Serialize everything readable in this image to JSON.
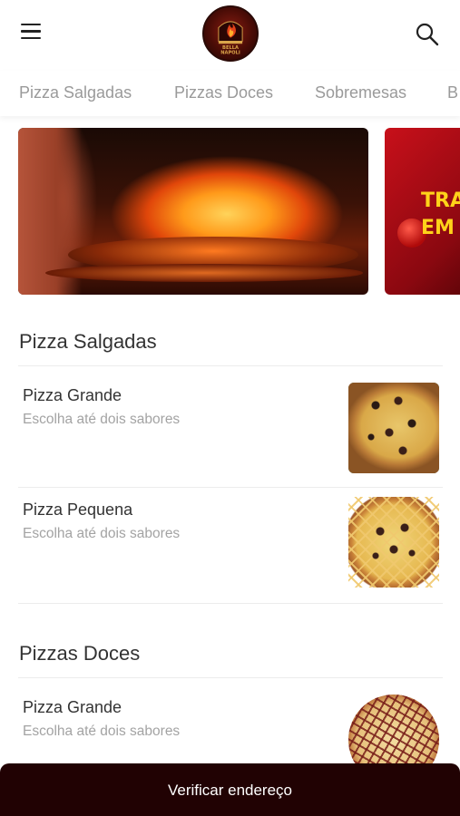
{
  "header": {
    "menu_icon": "hamburger-menu-icon",
    "logo_text": "BELLA NAPOLI",
    "search_icon": "search-icon"
  },
  "categories": [
    {
      "label": "Pizza Salgadas"
    },
    {
      "label": "Pizzas Doces"
    },
    {
      "label": "Sobremesas"
    },
    {
      "label": "B"
    }
  ],
  "banners": [
    {
      "name": "wood-fired-oven"
    },
    {
      "name": "promo",
      "text_line1": "TRA",
      "text_line2": "EM"
    }
  ],
  "sections": [
    {
      "title": "Pizza Salgadas",
      "products": [
        {
          "name": "Pizza Grande",
          "description": "Escolha até dois sabores"
        },
        {
          "name": "Pizza Pequena",
          "description": "Escolha até dois sabores"
        }
      ]
    },
    {
      "title": "Pizzas Doces",
      "products": [
        {
          "name": "Pizza Grande",
          "description": "Escolha até dois sabores"
        }
      ]
    }
  ],
  "bottom_bar": {
    "label": "Verificar endereço"
  },
  "colors": {
    "bottom_bar_bg": "#210203",
    "tab_text": "#9a9a9a",
    "promo_text": "#ffd21a",
    "promo_bg": "#c8101a"
  }
}
